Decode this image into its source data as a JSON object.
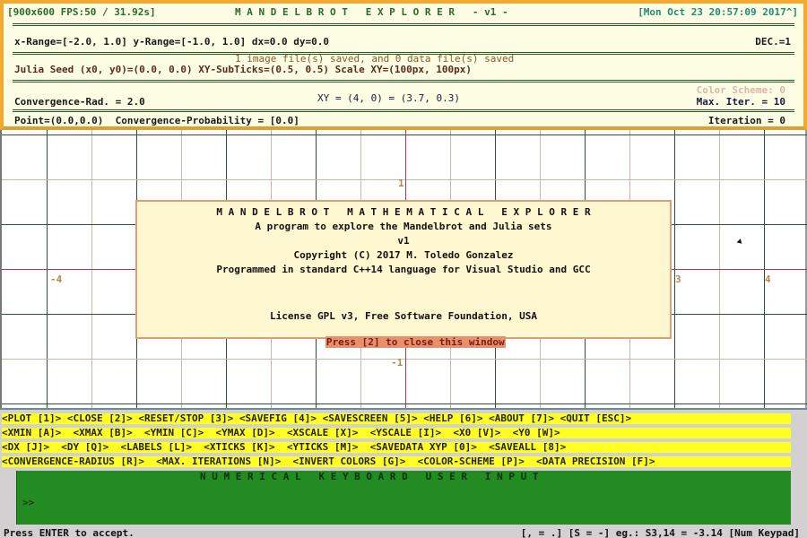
{
  "header": {
    "window_info": "[900x600 FPS:50 / 31.92s]",
    "title": "M A N D E L B R O T   E X P L O R E R   - v1 -",
    "datetime": "[Mon Oct 23 20:57:09 2017^]",
    "ranges": "x-Range=[-2.0, 1.0] y-Range=[-1.0, 1.0] dx=0.0 dy=0.0",
    "decimals": "DEC.=1",
    "saved_status": "1 image file(s) saved, and 0 data file(s) saved",
    "julia_line": "Julia Seed (x0, y0)=(0.0, 0.0) XY-SubTicks=(0.5, 0.5) Scale XY=(100px, 100px)",
    "color_scheme": "Color Scheme: 0",
    "convergence_radius": "Convergence-Rad. = 2.0",
    "xy_readout": "XY = (4, 0) = (3.7, 0.3)",
    "max_iterations": "Max. Iter. = 10",
    "point_line": "Point=(0.0,0.0)  Convergence-Probability = [0.0]",
    "iteration": "Iteration = 0"
  },
  "plot": {
    "axis_labels": {
      "x_neg4": "-4",
      "x_3": "3",
      "x_4": "4",
      "y_1": "1",
      "y_neg1": "-1"
    },
    "colors": {
      "major_grid": "#2f4f3f",
      "minor_grid": "#c8b8a8",
      "axis": "#c03050"
    }
  },
  "about_dialog": {
    "title": "M A N D E L B R O T   M A T H E M A T I C A L   E X P L O R E R",
    "subtitle": "A program to explore the Mandelbrot and Julia sets",
    "version": "v1",
    "copyright": "Copyright (C) 2017 M. Toledo Gonzalez",
    "programmed": "Programmed in standard C++14 language for Visual Studio and GCC",
    "license": "License GPL v3, Free Software Foundation, USA",
    "close_hint": "Press [2] to close this window"
  },
  "menu": {
    "rows": [
      [
        "<PLOT [1]>",
        "<CLOSE [2]>",
        "<RESET/STOP [3]>",
        "<SAVEFIG [4]>",
        "<SAVESCREEN [5]>",
        "<HELP [6]>",
        "<ABOUT [7]>",
        "<QUIT [ESC]>"
      ],
      [
        "<XMIN [A]>",
        "<XMAX [B]>",
        "<YMIN [C]>",
        "<YMAX [D]>",
        "<XSCALE [X]>",
        "<YSCALE [I]>",
        "<X0 [V]>",
        "<Y0 [W]>"
      ],
      [
        "<DX [J]>",
        "<DY [Q]>",
        "<LABELS [L]>",
        "<XTICKS [K]>",
        "<YTICKS [M]>",
        "<SAVEDATA XYP [0]>",
        "<SAVEALL [8]>"
      ],
      [
        "<CONVERGENCE-RADIUS [R]>",
        "<MAX. ITERATIONS [N]>",
        "<INVERT COLORS [G]>",
        "<COLOR-SCHEME [P]>",
        "<DATA PRECISION [F]>"
      ]
    ]
  },
  "keyboard": {
    "title": "N U M E R I C A L   K E Y B O A R D   U S E R   I N P U T",
    "prompt": ">>",
    "value": ""
  },
  "status": {
    "left": "Press ENTER to accept.",
    "right": "[, = .] [S = -] eg.: S3,14 = -3.14 [Num Keypad]"
  }
}
